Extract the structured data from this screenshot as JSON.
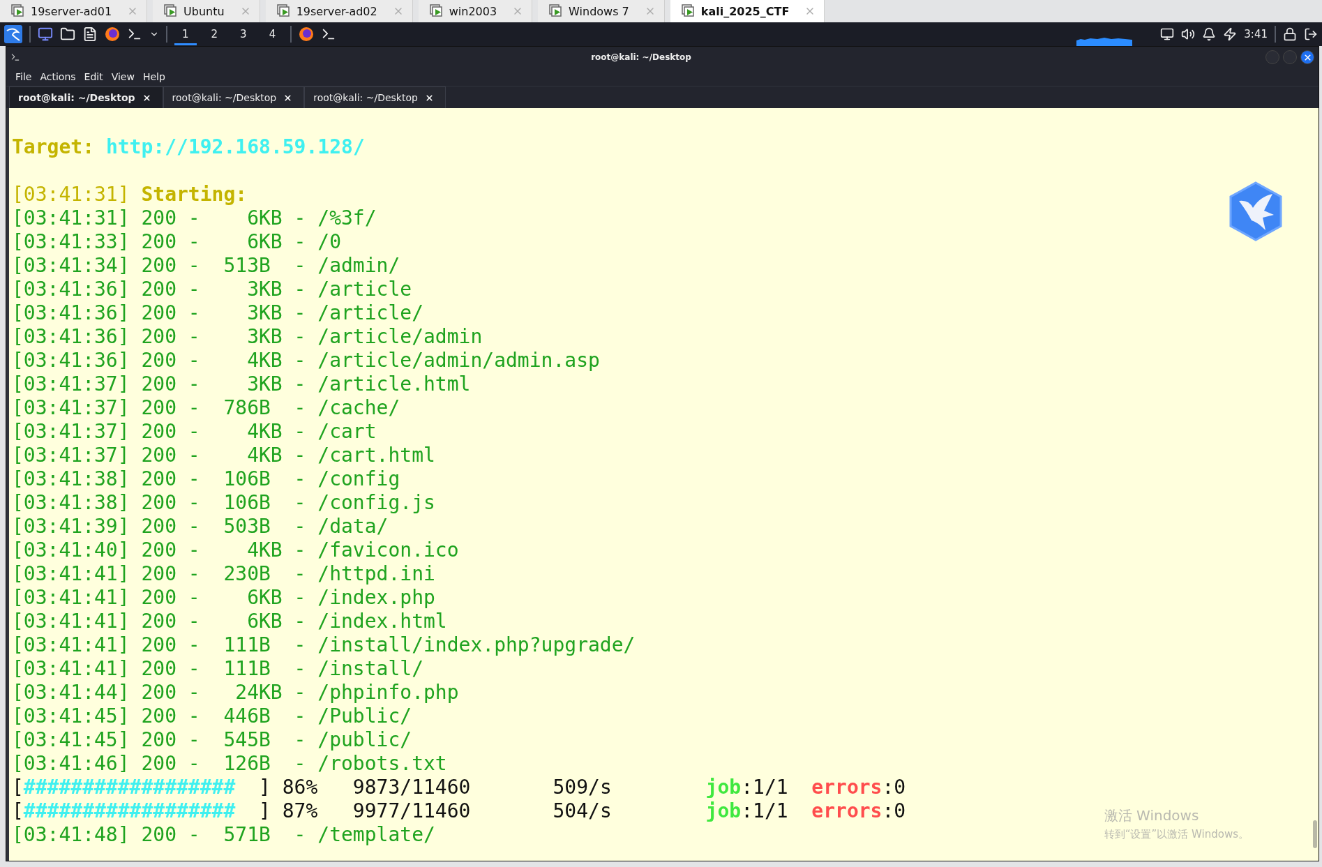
{
  "vm_tabs": [
    {
      "label": "19server-ad01",
      "selected": false
    },
    {
      "label": "Ubuntu",
      "selected": false
    },
    {
      "label": "19server-ad02",
      "selected": false
    },
    {
      "label": "win2003",
      "selected": false
    },
    {
      "label": "Windows 7",
      "selected": false
    },
    {
      "label": "kali_2025_CTF",
      "selected": true
    }
  ],
  "panel": {
    "workspaces": [
      {
        "label": "1",
        "selected": true
      },
      {
        "label": "2",
        "selected": false
      },
      {
        "label": "3",
        "selected": false
      },
      {
        "label": "4",
        "selected": false
      }
    ],
    "clock": "3:41"
  },
  "terminal": {
    "title": "root@kali: ~/Desktop",
    "menu": [
      "File",
      "Actions",
      "Edit",
      "View",
      "Help"
    ],
    "tabs": [
      {
        "label": "root@kali: ~/Desktop",
        "selected": true
      },
      {
        "label": "root@kali: ~/Desktop",
        "selected": false
      },
      {
        "label": "root@kali: ~/Desktop",
        "selected": false
      }
    ],
    "lines": [
      {
        "kind": "blank"
      },
      {
        "kind": "target",
        "label": "Target:",
        "url": "http://192.168.59.128/"
      },
      {
        "kind": "blank"
      },
      {
        "kind": "start",
        "time": "[03:41:31]",
        "label": "Starting:"
      },
      {
        "kind": "hit",
        "text": "[03:41:31] 200 -    6KB - /%3f/"
      },
      {
        "kind": "hit",
        "text": "[03:41:33] 200 -    6KB - /0"
      },
      {
        "kind": "hit",
        "text": "[03:41:34] 200 -  513B  - /admin/"
      },
      {
        "kind": "hit",
        "text": "[03:41:36] 200 -    3KB - /article"
      },
      {
        "kind": "hit",
        "text": "[03:41:36] 200 -    3KB - /article/"
      },
      {
        "kind": "hit",
        "text": "[03:41:36] 200 -    3KB - /article/admin"
      },
      {
        "kind": "hit",
        "text": "[03:41:36] 200 -    4KB - /article/admin/admin.asp"
      },
      {
        "kind": "hit",
        "text": "[03:41:37] 200 -    3KB - /article.html"
      },
      {
        "kind": "hit",
        "text": "[03:41:37] 200 -  786B  - /cache/"
      },
      {
        "kind": "hit",
        "text": "[03:41:37] 200 -    4KB - /cart"
      },
      {
        "kind": "hit",
        "text": "[03:41:37] 200 -    4KB - /cart.html"
      },
      {
        "kind": "hit",
        "text": "[03:41:38] 200 -  106B  - /config"
      },
      {
        "kind": "hit",
        "text": "[03:41:38] 200 -  106B  - /config.js"
      },
      {
        "kind": "hit",
        "text": "[03:41:39] 200 -  503B  - /data/"
      },
      {
        "kind": "hit",
        "text": "[03:41:40] 200 -    4KB - /favicon.ico"
      },
      {
        "kind": "hit",
        "text": "[03:41:41] 200 -  230B  - /httpd.ini"
      },
      {
        "kind": "hit",
        "text": "[03:41:41] 200 -    6KB - /index.php"
      },
      {
        "kind": "hit",
        "text": "[03:41:41] 200 -    6KB - /index.html"
      },
      {
        "kind": "hit",
        "text": "[03:41:41] 200 -  111B  - /install/index.php?upgrade/"
      },
      {
        "kind": "hit",
        "text": "[03:41:41] 200 -  111B  - /install/"
      },
      {
        "kind": "hit",
        "text": "[03:41:44] 200 -   24KB - /phpinfo.php"
      },
      {
        "kind": "hit",
        "text": "[03:41:45] 200 -  446B  - /Public/"
      },
      {
        "kind": "hit",
        "text": "[03:41:45] 200 -  545B  - /public/"
      },
      {
        "kind": "hit",
        "text": "[03:41:46] 200 -  126B  - /robots.txt"
      },
      {
        "kind": "progress",
        "open": "[",
        "bar": "##################",
        "rest": "  ] 86%   9873/11460       509/s        ",
        "job": "job",
        "job_value": ":1/1",
        "errors": "errors",
        "errors_value": ":0"
      },
      {
        "kind": "progress",
        "open": "[",
        "bar": "##################",
        "rest": "  ] 87%   9977/11460       504/s        ",
        "job": "job",
        "job_value": ":1/1",
        "errors": "errors",
        "errors_value": ":0"
      },
      {
        "kind": "hit",
        "text": "[03:41:48] 200 -  571B  - /template/"
      }
    ]
  },
  "activation": {
    "title": "激活 Windows",
    "subtitle": "转到“设置”以激活 Windows。"
  }
}
